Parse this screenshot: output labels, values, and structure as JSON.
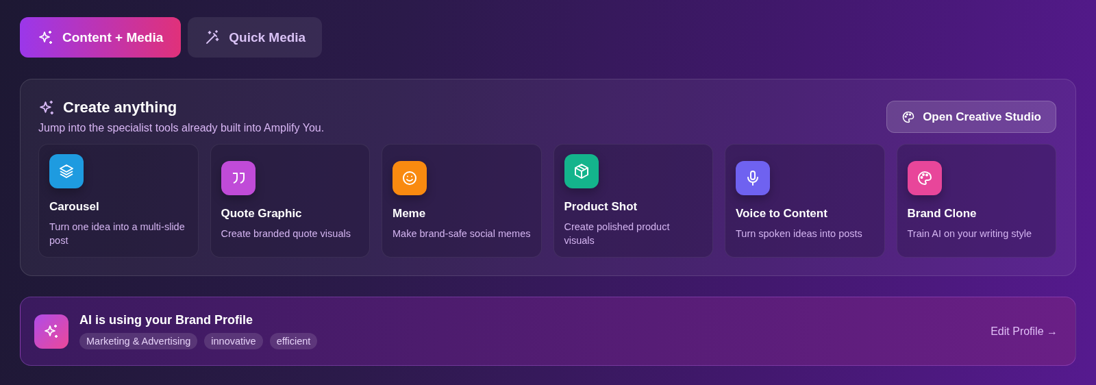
{
  "tabs": [
    {
      "label": "Content + Media",
      "selected": true
    },
    {
      "label": "Quick Media",
      "selected": false
    }
  ],
  "panel": {
    "title": "Create anything",
    "subtitle": "Jump into the specialist tools already built into Amplify You.",
    "button": "Open Creative Studio",
    "tools": [
      {
        "kind": "layers",
        "color": "#1e9be0",
        "title": "Carousel",
        "description": "Turn one idea into a multi-slide post"
      },
      {
        "kind": "quote",
        "color": "#c04bd8",
        "title": "Quote Graphic",
        "description": "Create branded quote visuals"
      },
      {
        "kind": "smile",
        "color": "#f98a10",
        "title": "Meme",
        "description": "Make brand-safe social memes"
      },
      {
        "kind": "box",
        "color": "#14b48c",
        "title": "Product Shot",
        "description": "Create polished product visuals"
      },
      {
        "kind": "mic",
        "color": "#6f62f0",
        "title": "Voice to Content",
        "description": "Turn spoken ideas into posts"
      },
      {
        "kind": "palette",
        "color": "#e8469a",
        "title": "Brand Clone",
        "description": "Train AI on your writing style"
      }
    ]
  },
  "brand": {
    "title": "AI is using your Brand Profile",
    "tags": [
      "Marketing & Advertising",
      "innovative",
      "efficient"
    ],
    "link": "Edit Profile →"
  }
}
